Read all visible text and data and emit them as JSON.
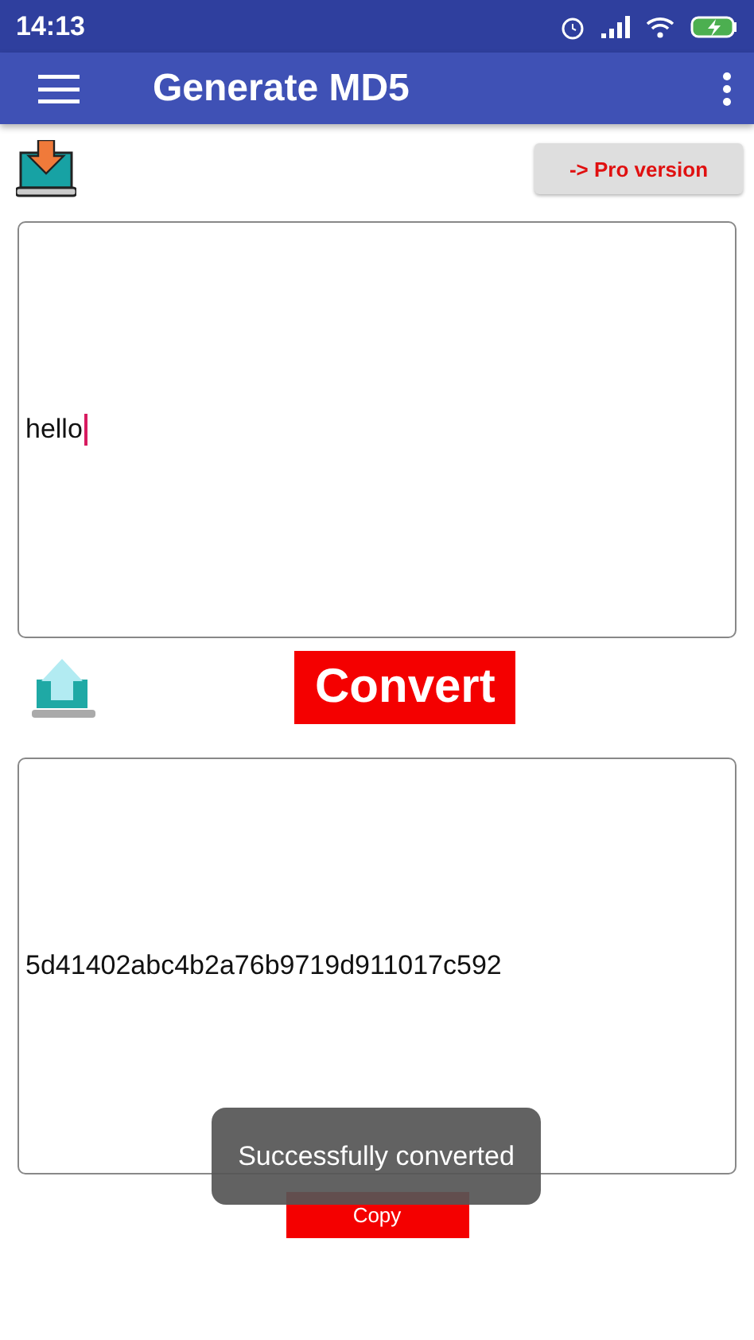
{
  "status_bar": {
    "time": "14:13"
  },
  "app_bar": {
    "title": "Generate MD5"
  },
  "pro_button": {
    "label": "-> Pro version"
  },
  "input": {
    "value": "hello",
    "focused": true
  },
  "convert_button": {
    "label": "Convert"
  },
  "output": {
    "value": "5d41402abc4b2a76b9719d911017c592"
  },
  "copy_button": {
    "label": "Copy"
  },
  "toast": {
    "message": "Successfully converted"
  }
}
